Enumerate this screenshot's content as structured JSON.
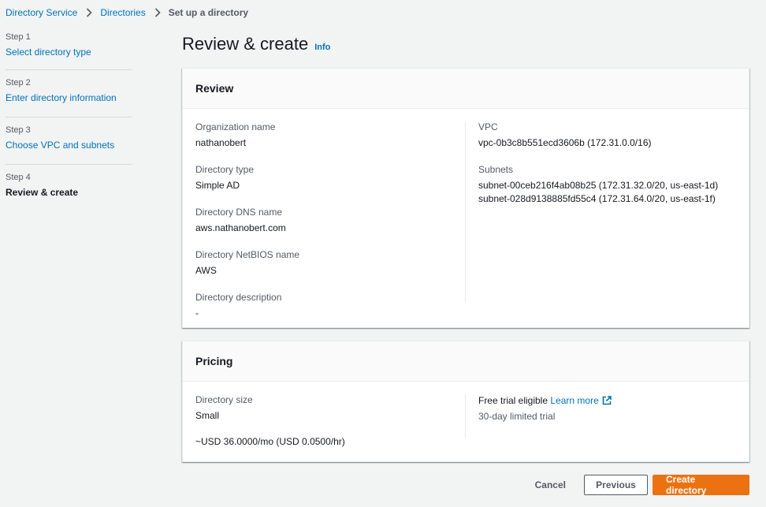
{
  "breadcrumb": {
    "items": [
      "Directory Service",
      "Directories"
    ],
    "current": "Set up a directory"
  },
  "steps": [
    {
      "num": "Step 1",
      "label": "Select directory type"
    },
    {
      "num": "Step 2",
      "label": "Enter directory information"
    },
    {
      "num": "Step 3",
      "label": "Choose VPC and subnets"
    },
    {
      "num": "Step 4",
      "label": "Review & create"
    }
  ],
  "page": {
    "title": "Review & create",
    "info": "Info"
  },
  "review": {
    "title": "Review",
    "org_label": "Organization name",
    "org_value": "nathanobert",
    "type_label": "Directory type",
    "type_value": "Simple AD",
    "dns_label": "Directory DNS name",
    "dns_value": "aws.nathanobert.com",
    "netbios_label": "Directory NetBIOS name",
    "netbios_value": "AWS",
    "desc_label": "Directory description",
    "desc_value": "-",
    "vpc_label": "VPC",
    "vpc_value": "vpc-0b3c8b551ecd3606b (172.31.0.0/16)",
    "subnets_label": "Subnets",
    "subnets": [
      "subnet-00ceb216f4ab08b25 (172.31.32.0/20, us-east-1d)",
      "subnet-028d9138885fd55c4 (172.31.64.0/20, us-east-1f)"
    ]
  },
  "pricing": {
    "title": "Pricing",
    "size_label": "Directory size",
    "size_value": "Small",
    "cost": "~USD 36.0000/mo (USD 0.0500/hr)",
    "trial_label": "Free trial eligible",
    "learn_more": "Learn more",
    "trial_note": "30-day limited trial"
  },
  "actions": {
    "cancel": "Cancel",
    "previous": "Previous",
    "create": "Create directory"
  },
  "colors": {
    "link": "#0073bb",
    "primary": "#ec7211",
    "background": "#f2f3f3"
  },
  "icons": {
    "breadcrumb_separator": "chevron-right-icon",
    "external": "external-link-icon"
  }
}
